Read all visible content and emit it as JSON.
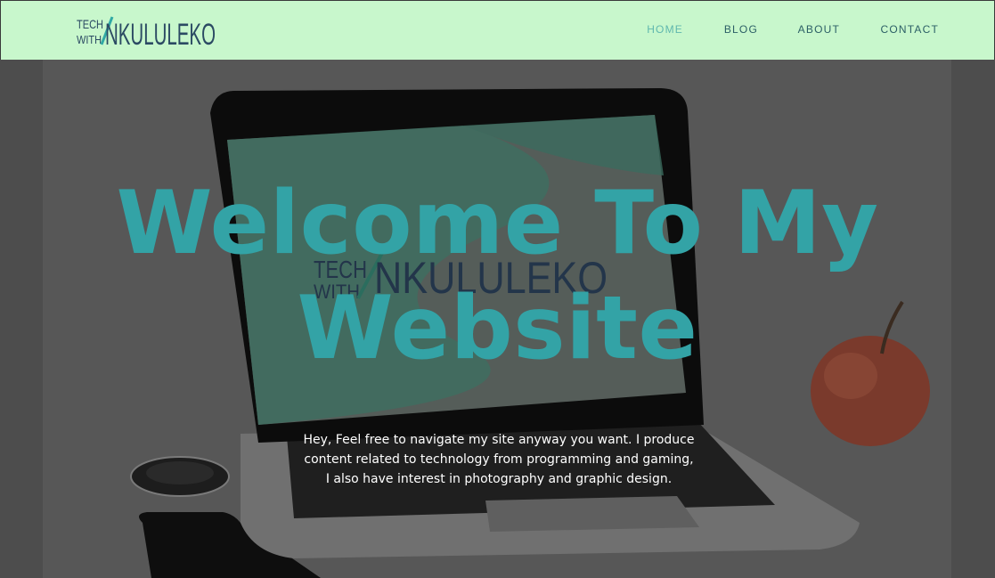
{
  "header": {
    "logo": {
      "line1": "TECH",
      "line2": "WITH",
      "name": "NKULULEKO"
    },
    "nav": [
      {
        "label": "HOME",
        "active": true
      },
      {
        "label": "BLOG",
        "active": false
      },
      {
        "label": "ABOUT",
        "active": false
      },
      {
        "label": "CONTACT",
        "active": false
      }
    ]
  },
  "hero": {
    "title": "Welcome To My Website",
    "text": "Hey, Feel free to navigate my site anyway you want. I produce content related to technology from programming and gaming, I also have interest in photography and graphic design."
  },
  "colors": {
    "header_bg": "#c8f7cc",
    "accent": "#33a3a6",
    "nav_text": "#2c5f66",
    "nav_active": "#5fb7ae"
  }
}
